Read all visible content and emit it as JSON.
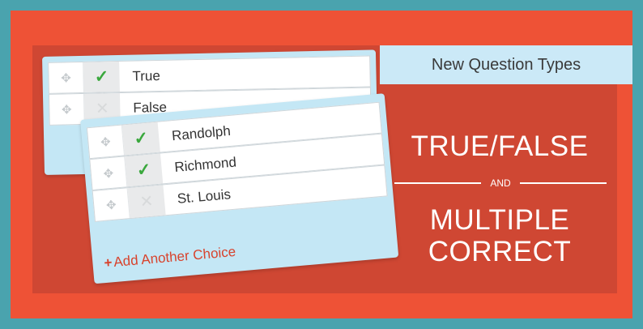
{
  "tag_label": "New Question Types",
  "headline": {
    "line1": "TRUE/FALSE",
    "connector": "AND",
    "line2": "MULTIPLE",
    "line3": "CORRECT"
  },
  "true_false_card": {
    "choices": [
      {
        "label": "True",
        "correct": true
      },
      {
        "label": "False",
        "correct": false
      }
    ]
  },
  "multiple_correct_card": {
    "choices": [
      {
        "label": "Randolph",
        "correct": true
      },
      {
        "label": "Richmond",
        "correct": true
      },
      {
        "label": "St. Louis",
        "correct": false
      }
    ],
    "add_choice_plus": "+",
    "add_choice_label": "Add Another Choice"
  },
  "icons": {
    "drag": "drag-handle-icon",
    "check": "checkmark-icon",
    "unchecked": "x-icon"
  },
  "colors": {
    "border": "#4aa3ae",
    "frame": "#ee5236",
    "panel": "#cf4733",
    "tag": "#cbe9f7",
    "check": "#3aa83d",
    "add_choice": "#d8432d"
  }
}
